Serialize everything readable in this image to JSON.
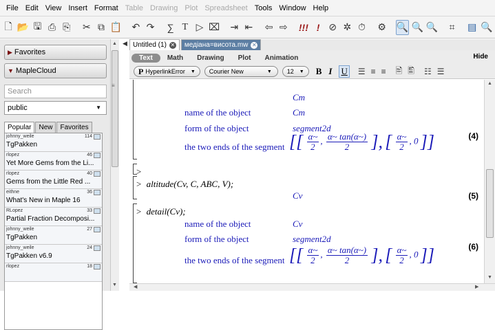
{
  "menubar": [
    "File",
    "Edit",
    "View",
    "Insert",
    "Format",
    "Table",
    "Drawing",
    "Plot",
    "Spreadsheet",
    "Tools",
    "Window",
    "Help"
  ],
  "menubar_disabled": [
    "Table",
    "Drawing",
    "Plot",
    "Spreadsheet"
  ],
  "palette": {
    "favorites": "Favorites",
    "maplecloud": "MapleCloud",
    "search_placeholder": "Search",
    "group": "public",
    "tabs": [
      "Popular",
      "New",
      "Favorites"
    ],
    "items": [
      {
        "author": "johnny_weile",
        "count": "114",
        "title": "TgPakken"
      },
      {
        "author": "rlopez",
        "count": "46",
        "title": "Yet More Gems from the Li..."
      },
      {
        "author": "rlopez",
        "count": "40",
        "title": "Gems from the Little Red ..."
      },
      {
        "author": "eithne",
        "count": "36",
        "title": "What's New in Maple 16"
      },
      {
        "author": "RLopez",
        "count": "33",
        "title": "Partial Fraction Decomposi..."
      },
      {
        "author": "johnny_weile",
        "count": "27",
        "title": "TgPakken"
      },
      {
        "author": "johnny_weile",
        "count": "24",
        "title": "TgPakken v6.9"
      },
      {
        "author": "rlopez",
        "count": "18",
        "title": ""
      }
    ]
  },
  "doctabs": [
    {
      "label": "Untitled (1)"
    },
    {
      "label": "медіана=висота.mw"
    }
  ],
  "context": {
    "modes": [
      "Text",
      "Math",
      "Drawing",
      "Plot",
      "Animation"
    ],
    "hide": "Hide",
    "style": "HyperlinkError",
    "font": "Courier New",
    "size": "12",
    "bold": "B",
    "italic": "I",
    "underline": "U"
  },
  "doc": {
    "top_partial": "Cm",
    "block1": {
      "name_label": "name of the object",
      "name_value": "Cm",
      "form_label": "form of the object",
      "form_value": "segment2d",
      "ends_label": "the two ends of the segment",
      "alpha": "α~",
      "tan_expr": "α~ tan(α~)",
      "two": "2",
      "zero": "0",
      "eq": "(4)"
    },
    "cmd1": "altitude(Cv, C, ABC, V);",
    "out1": "Cv",
    "eq5": "(5)",
    "cmd2": "detail(Cv);",
    "block2": {
      "name_label": "name of the object",
      "name_value": "Cv",
      "form_label": "form of the object",
      "form_value": "segment2d",
      "ends_label": "the two ends of the segment",
      "eq": "(6)"
    },
    "prompt_symbol": ">",
    "comma": ","
  }
}
